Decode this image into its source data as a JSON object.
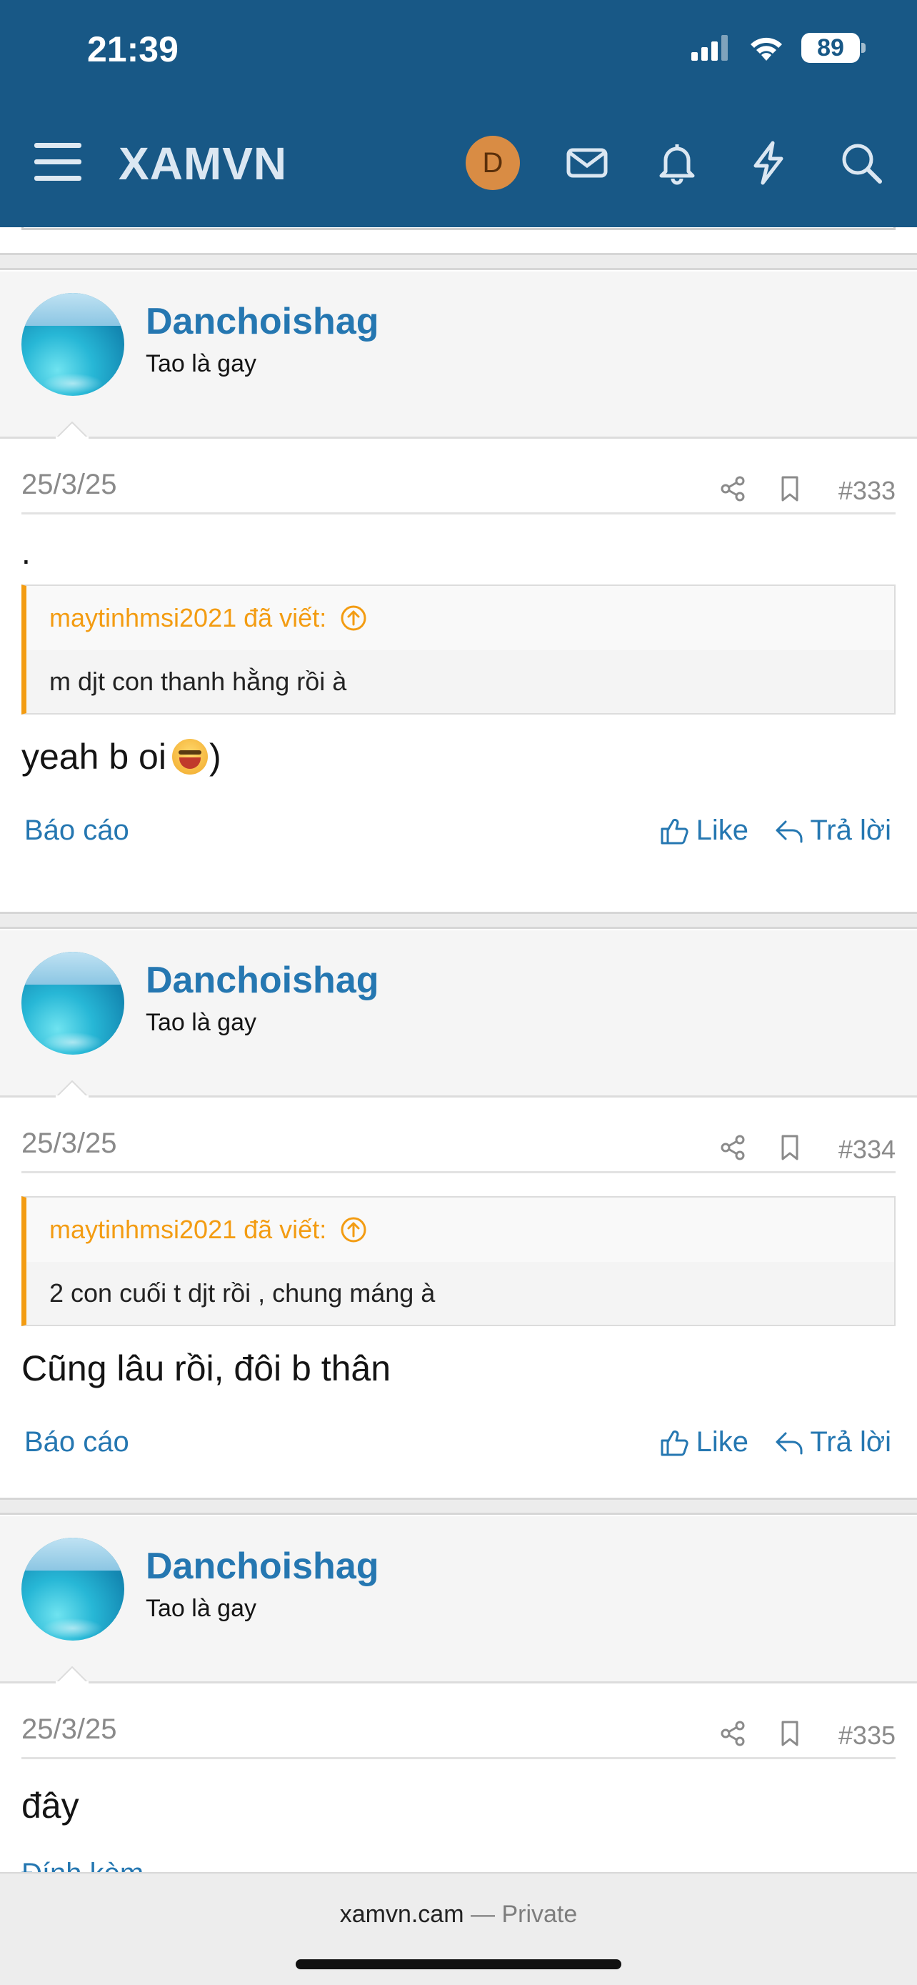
{
  "status_bar": {
    "time": "21:39",
    "battery": "89"
  },
  "header": {
    "brand": "XAMVN",
    "avatar_letter": "D",
    "icons": [
      "menu-icon",
      "mail-icon",
      "bell-icon",
      "lightning-icon",
      "search-icon"
    ]
  },
  "posts": [
    {
      "username": "Danchoishag",
      "user_title": "Tao là gay",
      "date": "25/3/25",
      "number": "#333",
      "leading_text": ".",
      "quote_author": "maytinhmsi2021 đã viết:",
      "quote_text": "m djt con thanh hằng rồi à",
      "message": "yeah b oi",
      "message_suffix": ")",
      "report_label": "Báo cáo",
      "like_label": "Like",
      "reply_label": "Trả lời"
    },
    {
      "username": "Danchoishag",
      "user_title": "Tao là gay",
      "date": "25/3/25",
      "number": "#334",
      "quote_author": "maytinhmsi2021 đã viết:",
      "quote_text": "2 con cuối t djt rồi , chung máng à",
      "message": "Cũng lâu rồi, đôi b thân",
      "report_label": "Báo cáo",
      "like_label": "Like",
      "reply_label": "Trả lời"
    },
    {
      "username": "Danchoishag",
      "user_title": "Tao là gay",
      "date": "25/3/25",
      "number": "#335",
      "message": "đây",
      "partial_label": "Đính kèm"
    }
  ],
  "browser": {
    "url": "xamvn.cam",
    "separator": " — ",
    "mode": "Private"
  },
  "colors": {
    "header": "#185886",
    "link": "#2577b1",
    "quote_accent": "#f39c12",
    "avatar_d": "#d98c44"
  }
}
